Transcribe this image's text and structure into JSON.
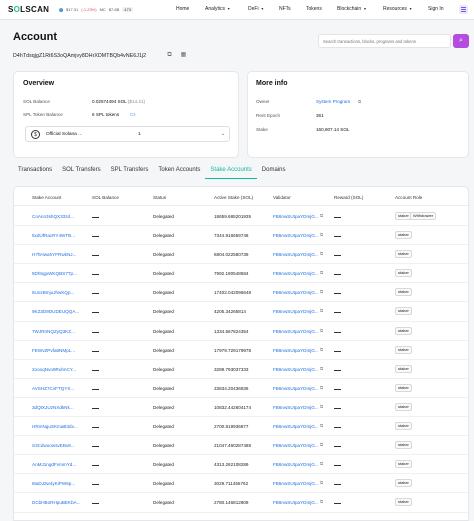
{
  "topbar": {
    "logo": "SOLSCAN",
    "sol_price": "$17.31",
    "sol_change": "(-1.23%)",
    "network_label": "MC",
    "market_cap": "$7.8B",
    "tps_badge": "473",
    "nav": [
      {
        "label": "Home",
        "dropdown": false
      },
      {
        "label": "Analytics",
        "dropdown": true
      },
      {
        "label": "DeFi",
        "dropdown": true
      },
      {
        "label": "NFTs",
        "dropdown": false
      },
      {
        "label": "Tokens",
        "dropdown": false
      },
      {
        "label": "Blockchain",
        "dropdown": true
      },
      {
        "label": "Resources",
        "dropdown": true
      },
      {
        "label": "Sign In",
        "dropdown": false
      }
    ],
    "accent_color": "#b44ce0"
  },
  "header": {
    "title": "Account",
    "search_placeholder": "Search transactions, blocks, programs and tokens",
    "address": "D4hTdsqjgZ1Rt6S3oQAmjvy8DHrXDMTBQb4vNE6J1j2"
  },
  "overview": {
    "title": "Overview",
    "sol_balance_label": "SOL Balance",
    "sol_balance_value": "0.02574494 SOL",
    "sol_balance_usd": "($14.21)",
    "spl_label": "SPL Token Balance",
    "spl_value": "6 SPL tokens",
    "token_select_name": "Official Solana ...",
    "token_select_count": "1"
  },
  "more_info": {
    "title": "More info",
    "owner_label": "Owner",
    "owner_value": "System Program",
    "rent_label": "Rent Epoch",
    "rent_value": "361",
    "stake_label": "Stake",
    "stake_value": "160,807.14 SOL"
  },
  "tabs": [
    "Transactions",
    "SOL Transfers",
    "SPL Transfers",
    "Token Accounts",
    "Stake Accounts",
    "Domains"
  ],
  "active_tab": "Stake Accounts",
  "table": {
    "headers": [
      "Stake Account",
      "SOL Balance",
      "Status",
      "Active Stake (SOL)",
      "Validator",
      "Reward (SOL)",
      "Account Role"
    ],
    "rows": [
      {
        "account": "CoAnn3shQX33zd...",
        "status": "Delegated",
        "stake": "18659.685201935",
        "validator": "FB6nwSUtpaYDmjG...",
        "roles": [
          "staker",
          "Withdrawer"
        ]
      },
      {
        "account": "5xdUfRacRY4WTB...",
        "status": "Delegated",
        "stake": "7344.916659748",
        "validator": "FB6nwSUtpaYDmjG...",
        "roles": [
          "staker"
        ]
      },
      {
        "account": "H7hHwahYFRwkNJ...",
        "status": "Delegated",
        "stake": "6804.022580739",
        "validator": "FB6nwSUtpaYDmjG...",
        "roles": [
          "staker"
        ]
      },
      {
        "account": "5Dh5gpWKQBS7Tp...",
        "status": "Delegated",
        "stake": "7992.190548584",
        "validator": "FB6nwSUtpaYDmjG...",
        "roles": [
          "staker"
        ]
      },
      {
        "account": "5UozBmjuJhwKQp...",
        "status": "Delegated",
        "stake": "17402.042096648",
        "validator": "FB6nwSUtpaYDmjG...",
        "roles": [
          "staker"
        ]
      },
      {
        "account": "9KZ3D9DUDEUQQA...",
        "status": "Delegated",
        "stake": "4205.34265814",
        "validator": "FB6nwSUtpaYDmjG...",
        "roles": [
          "staker"
        ]
      },
      {
        "account": "7WJRnNQZyQ3KZ...",
        "status": "Delegated",
        "stake": "1334.567824354",
        "validator": "FB6nwSUtpaYDmjG...",
        "roles": [
          "staker"
        ]
      },
      {
        "account": "FEWvZPvfa6NMpL...",
        "status": "Delegated",
        "stake": "17979.729179978",
        "validator": "FB6nwSUtpaYDmjG...",
        "roles": [
          "staker"
        ]
      },
      {
        "account": "2oooqNvo9RuhnCY...",
        "status": "Delegated",
        "stake": "3289.793037333",
        "validator": "FB6nwSUtpaYDmjG...",
        "roles": [
          "staker"
        ]
      },
      {
        "account": "AVSHZ7CvFTQYX...",
        "status": "Delegated",
        "stake": "33834.20436836",
        "validator": "FB6nwSUtpaYDmjG...",
        "roles": [
          "staker"
        ]
      },
      {
        "account": "3dQtXJUzNXdkNk...",
        "status": "Delegated",
        "stake": "10832.442604174",
        "validator": "FB6nwSUtpaYDmjG...",
        "roles": [
          "staker"
        ]
      },
      {
        "account": "HRmNguSKmaB3dx...",
        "status": "Delegated",
        "stake": "2700.819936877",
        "validator": "FB6nwSUtpaYDmjG...",
        "roles": [
          "staker"
        ]
      },
      {
        "account": "S3CdwoowsvEBv8...",
        "status": "Delegated",
        "stake": "21047.460287488",
        "validator": "FB6nwSUtpaYDmjG...",
        "roles": [
          "staker"
        ]
      },
      {
        "account": "AnMJ1ngdFvmmYd...",
        "status": "Delegated",
        "stake": "4313.262108289",
        "validator": "FB6nwSUtpaYDmjG...",
        "roles": [
          "staker"
        ]
      },
      {
        "account": "6taDJ2w4yKiPW6p...",
        "status": "Delegated",
        "stake": "3029.711455762",
        "validator": "FB6nwSUtpaYDmjG...",
        "roles": [
          "staker"
        ]
      },
      {
        "account": "DCbHBoRHpuBEKbA...",
        "status": "Delegated",
        "stake": "2780.146812809",
        "validator": "FB6nwSUtpaYDmjG...",
        "roles": [
          "staker"
        ]
      }
    ]
  }
}
